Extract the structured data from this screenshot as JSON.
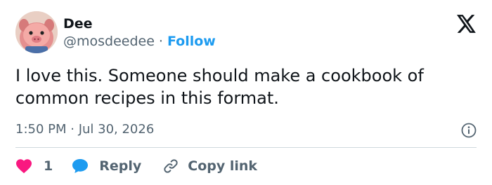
{
  "author": {
    "name": "Dee",
    "handle": "@mosdeedee",
    "separator": "·",
    "follow_label": "Follow",
    "avatar_icon": "pig-character-avatar"
  },
  "brand": {
    "logo_icon": "x-logo"
  },
  "tweet": {
    "text": "I love this. Someone should make a cookbook of common recipes in this format.",
    "timestamp": "1:50 PM · Jul 30, 2026"
  },
  "actions": {
    "like_count": "1",
    "reply_label": "Reply",
    "copy_link_label": "Copy link"
  },
  "colors": {
    "accent": "#1d9bf0",
    "like": "#f91880",
    "secondary_text": "#536471",
    "divider": "#cfd9de"
  }
}
